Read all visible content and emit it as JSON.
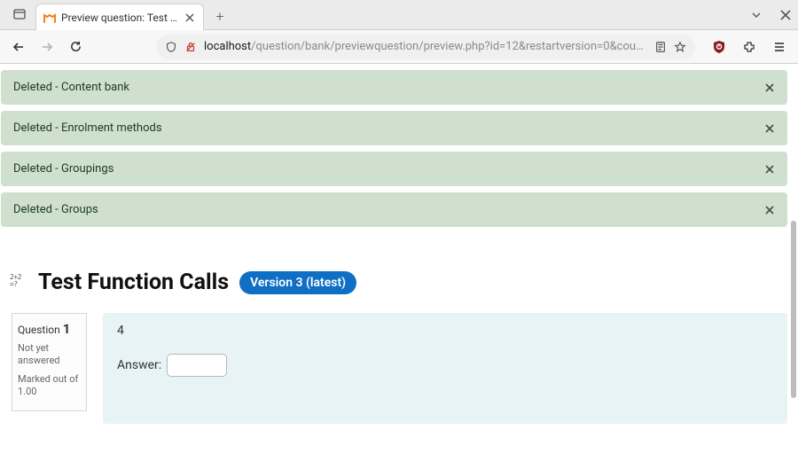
{
  "browser": {
    "tab_title": "Preview question: Test F…",
    "url_host": "localhost",
    "url_path": "/question/bank/previewquestion/preview.php?id=12&restartversion=0&courseid"
  },
  "alerts": [
    {
      "text": "Deleted - Content bank"
    },
    {
      "text": "Deleted - Enrolment methods"
    },
    {
      "text": "Deleted - Groupings"
    },
    {
      "text": "Deleted - Groups"
    }
  ],
  "heading": {
    "icon_text": "2+2\n=?",
    "title": "Test Function Calls",
    "version_badge": "Version 3 (latest)"
  },
  "question_info": {
    "label": "Question",
    "number": "1",
    "status": "Not yet answered",
    "mark_line": "Marked out of 1.00"
  },
  "question_body": {
    "text": "4",
    "answer_label": "Answer:",
    "answer_value": ""
  }
}
